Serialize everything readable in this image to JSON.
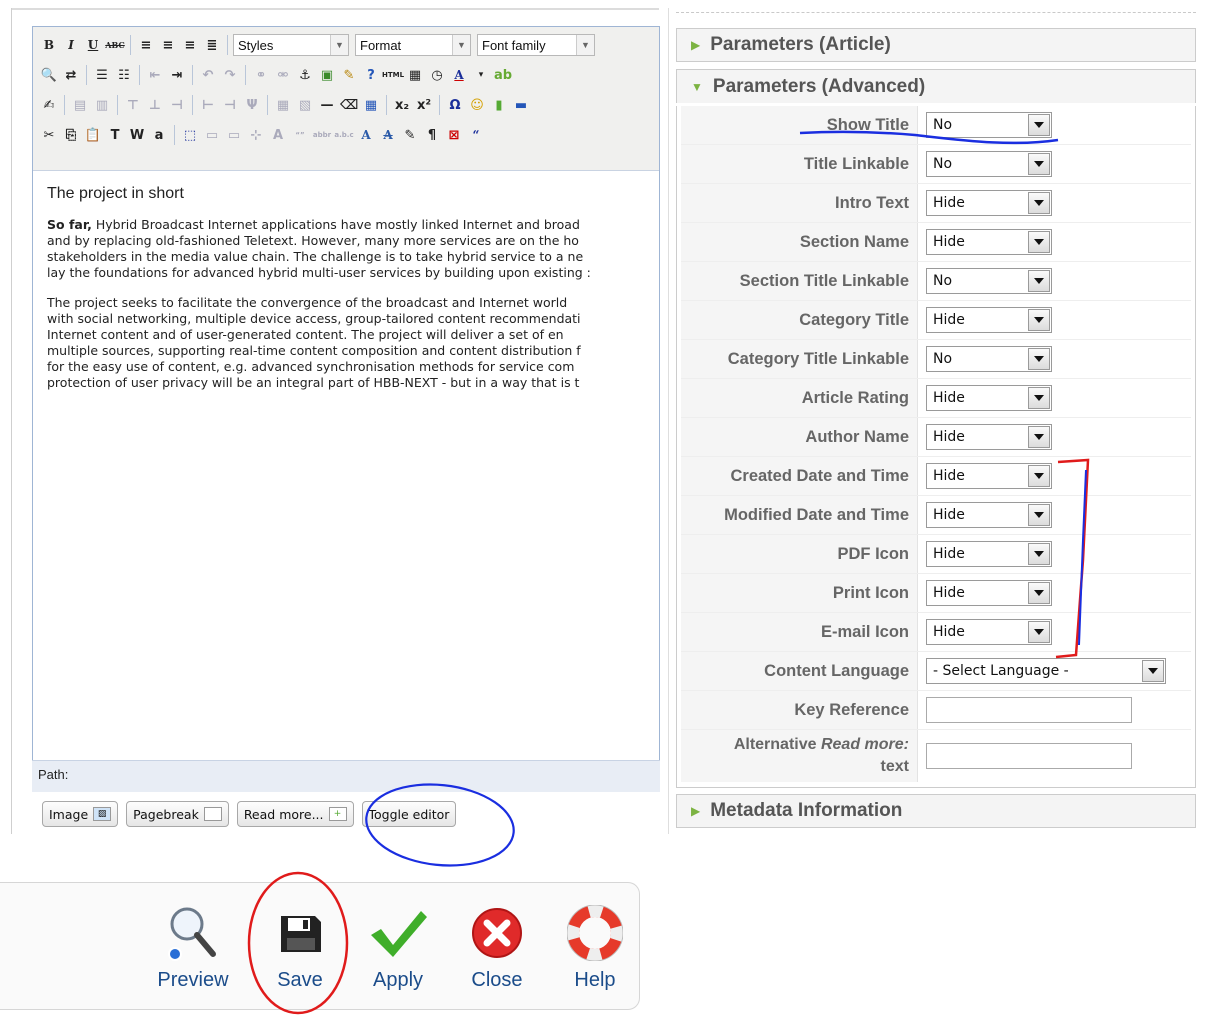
{
  "editor": {
    "toolbar": {
      "styles_label": "Styles",
      "format_label": "Format",
      "font_family_label": "Font family"
    },
    "content": {
      "heading": "The project in short",
      "p1_bold": "So far,",
      "p1_lines": [
        " Hybrid Broadcast Internet applications have mostly linked Internet and broad",
        "and by replacing old-fashioned Teletext. However, many more services are on the ho",
        "stakeholders in the media value chain. The challenge is to take hybrid service to a ne",
        "lay the foundations for advanced hybrid multi-user services by building upon existing :"
      ],
      "p2_lines": [
        "The project seeks to facilitate the convergence of the broadcast and Internet world",
        "with social networking, multiple device access, group-tailored content recommendati",
        "Internet content and of user-generated content. The project will deliver a set of en",
        "multiple sources, supporting real-time content composition and content distribution f",
        "for the easy use of content, e.g. advanced synchronisation methods for service com",
        "protection of user privacy will be an integral part of HBB-NEXT - but in a way that is t"
      ]
    },
    "path_label": "Path:",
    "buttons": [
      "Image",
      "Pagebreak",
      "Read more...",
      "Toggle editor"
    ]
  },
  "actions": [
    {
      "label": "Preview",
      "icon": "magnifier-icon"
    },
    {
      "label": "Save",
      "icon": "floppy-disk-icon"
    },
    {
      "label": "Apply",
      "icon": "checkmark-icon"
    },
    {
      "label": "Close",
      "icon": "close-circle-icon"
    },
    {
      "label": "Help",
      "icon": "lifebuoy-icon"
    }
  ],
  "panels": {
    "article": "Parameters (Article)",
    "advanced": "Parameters (Advanced)",
    "metadata": "Metadata Information"
  },
  "params": [
    {
      "label": "Show Title",
      "value": "No"
    },
    {
      "label": "Title Linkable",
      "value": "No"
    },
    {
      "label": "Intro Text",
      "value": "Hide"
    },
    {
      "label": "Section Name",
      "value": "Hide"
    },
    {
      "label": "Section Title Linkable",
      "value": "No"
    },
    {
      "label": "Category Title",
      "value": "Hide"
    },
    {
      "label": "Category Title Linkable",
      "value": "No"
    },
    {
      "label": "Article Rating",
      "value": "Hide"
    },
    {
      "label": "Author Name",
      "value": "Hide"
    },
    {
      "label": "Created Date and Time",
      "value": "Hide"
    },
    {
      "label": "Modified Date and Time",
      "value": "Hide"
    },
    {
      "label": "PDF Icon",
      "value": "Hide"
    },
    {
      "label": "Print Icon",
      "value": "Hide"
    },
    {
      "label": "E-mail Icon",
      "value": "Hide"
    }
  ],
  "content_language": {
    "label": "Content Language",
    "value": "- Select Language -"
  },
  "key_reference": {
    "label": "Key Reference",
    "value": ""
  },
  "read_more": {
    "label_normal": "Alternative",
    "label_italic": "Read more:",
    "label_tail": "text",
    "value": ""
  },
  "colors": {
    "link_blue": "#1b4c8a",
    "annotation_blue": "#1a2ee0",
    "annotation_red": "#e01b1b",
    "triangle_green": "#7cb342"
  }
}
